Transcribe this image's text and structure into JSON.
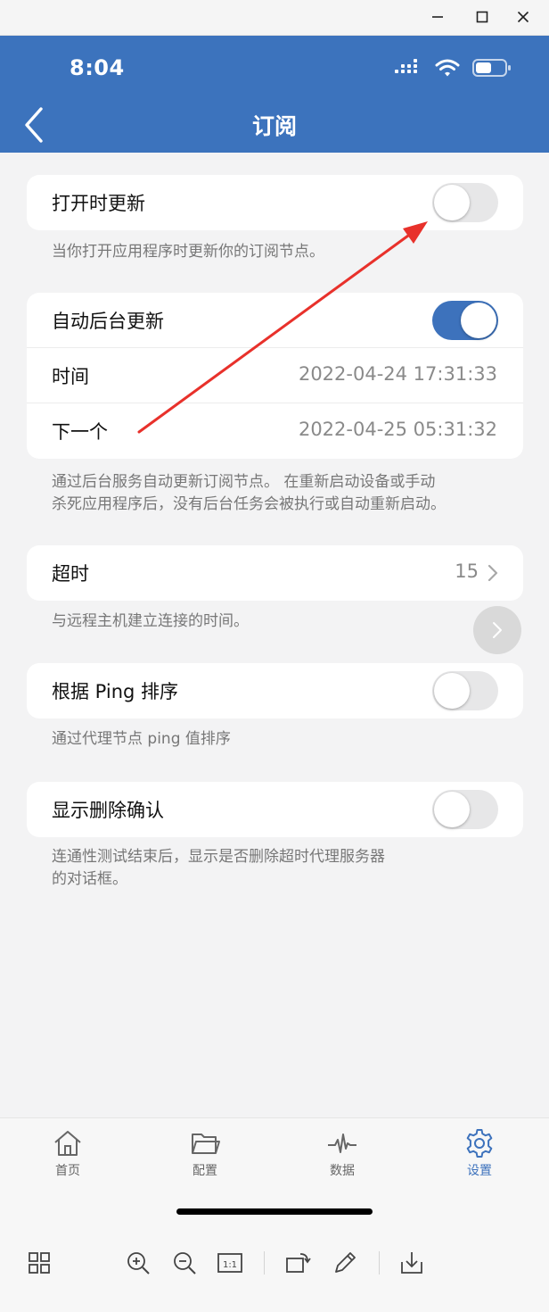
{
  "status": {
    "time": "8:04"
  },
  "header": {
    "title": "订阅"
  },
  "sections": {
    "update_on_open": {
      "label": "打开时更新",
      "enabled": false,
      "note": "当你打开应用程序时更新你的订阅节点。"
    },
    "auto_background": {
      "label": "自动后台更新",
      "enabled": true,
      "time_label": "时间",
      "time_value": "2022-04-24 17:31:33",
      "next_label": "下一个",
      "next_value": "2022-04-25 05:31:32",
      "note_line1": "通过后台服务自动更新订阅节点。 在重新启动设备或手动",
      "note_line2": "杀死应用程序后，没有后台任务会被执行或自动重新启动。"
    },
    "timeout": {
      "label": "超时",
      "value": "15",
      "note": "与远程主机建立连接的时间。"
    },
    "ping_sort": {
      "label": "根据 Ping 排序",
      "enabled": false,
      "note": "通过代理节点 ping 值排序"
    },
    "delete_confirm": {
      "label": "显示删除确认",
      "enabled": false,
      "note_line1": "连通性测试结束后，显示是否删除超时代理服务器",
      "note_line2": "的对话框。"
    }
  },
  "tabbar": {
    "items": [
      {
        "label": "首页",
        "icon": "home-icon",
        "active": false
      },
      {
        "label": "配置",
        "icon": "folder-icon",
        "active": false
      },
      {
        "label": "数据",
        "icon": "activity-icon",
        "active": false
      },
      {
        "label": "设置",
        "icon": "gear-icon",
        "active": true
      }
    ]
  },
  "colors": {
    "accent": "#3c73bd",
    "annotation_arrow": "#e8312b"
  }
}
